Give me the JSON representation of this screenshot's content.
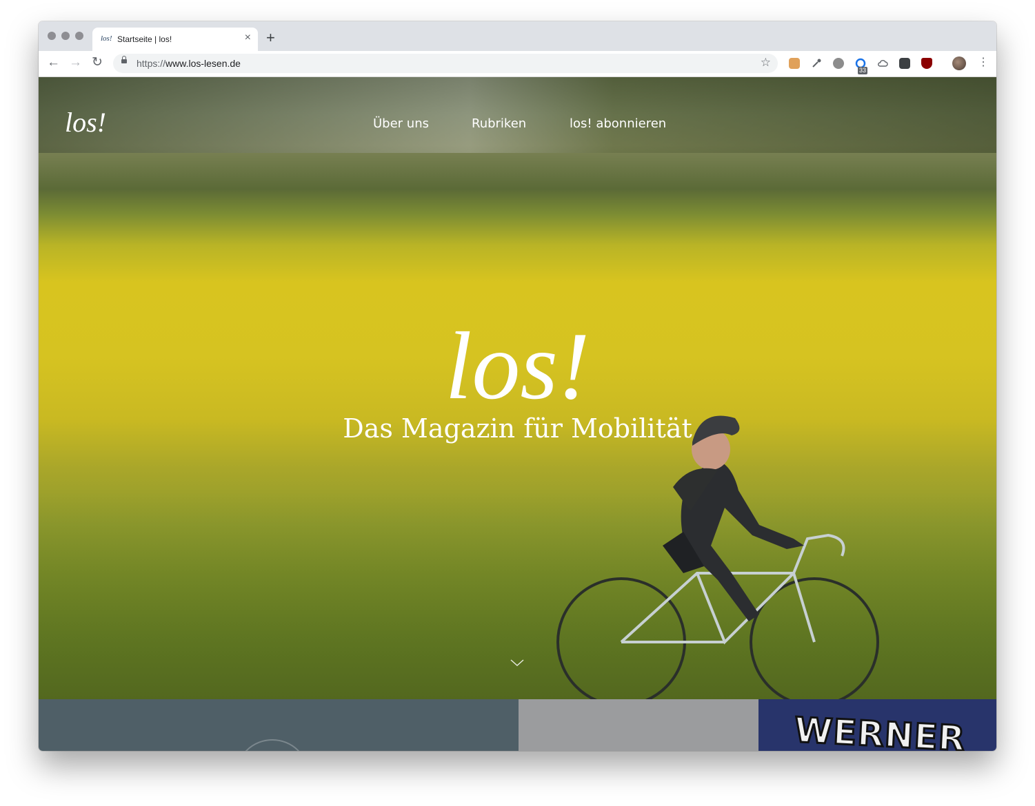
{
  "browser": {
    "tab": {
      "favicon_text": "los!",
      "title": "Startseite | los!"
    },
    "url": {
      "scheme": "https://",
      "host": "www.los-lesen.de"
    },
    "extension_badge": "33"
  },
  "site": {
    "logo": "los!",
    "nav": [
      "Über uns",
      "Rubriken",
      "los! abonnieren"
    ],
    "hero_title": "los!",
    "hero_subtitle": "Das Magazin für Mobilität"
  },
  "tiles": {
    "werner": "WERNER"
  },
  "colors": {
    "hero_yellow": "#d8c41f",
    "hero_green": "#6a8226",
    "tile_slate": "#4f5f67",
    "tile_gray": "#9b9c9e",
    "tile_navy": "#28346b"
  }
}
